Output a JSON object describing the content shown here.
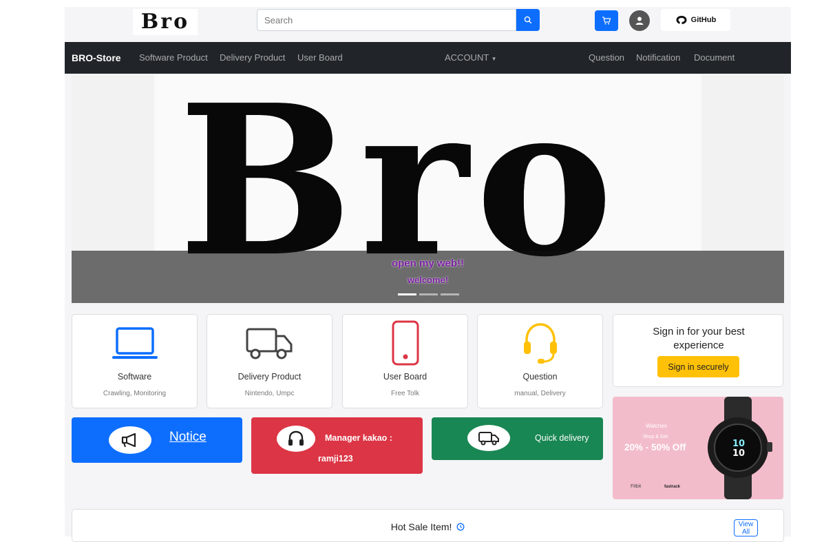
{
  "header": {
    "logo": "Bro",
    "search_placeholder": "Search",
    "github_label": "GitHub"
  },
  "navbar": {
    "brand": "BRO-Store",
    "left_links": [
      "Software Product",
      "Delivery Product",
      "User Board"
    ],
    "account": "ACCOUNT",
    "right_links": [
      "Question",
      "Notification",
      "Document"
    ]
  },
  "hero": {
    "big_text": "Bro",
    "caption_line1": "open my web!!",
    "caption_line2": "welcome!",
    "slide_count": 3,
    "active_slide": 1
  },
  "categories": [
    {
      "title": "Software",
      "sub": "Crawling, Monitoring",
      "icon": "laptop-icon",
      "color": "#0d6efd"
    },
    {
      "title": "Delivery Product",
      "sub": "Nintendo, Umpc",
      "icon": "truck-icon",
      "color": "#444444"
    },
    {
      "title": "User Board",
      "sub": "Free Tolk",
      "icon": "phone-icon",
      "color": "#dc3545"
    },
    {
      "title": "Question",
      "sub": "manual, Delivery",
      "icon": "headset-icon",
      "color": "#ffc107"
    }
  ],
  "signin": {
    "text": "Sign in for your best experience",
    "button": "Sign in securely"
  },
  "banners": {
    "notice": "Notice",
    "kakao_line1": "Manager kakao :",
    "kakao_line2": "ramji123",
    "quick": "Quick delivery"
  },
  "ad": {
    "line1": "Watches",
    "line2": "Shop & Get",
    "line3": "20% - 50% Off",
    "brand1": "Fitbit",
    "brand2": "fastrack"
  },
  "hot_sale": {
    "title": "Hot Sale Item!",
    "view_all": "View All"
  },
  "colors": {
    "primary": "#0d6efd",
    "danger": "#dc3545",
    "success": "#198754",
    "warning": "#ffc107",
    "dark": "#212529"
  }
}
